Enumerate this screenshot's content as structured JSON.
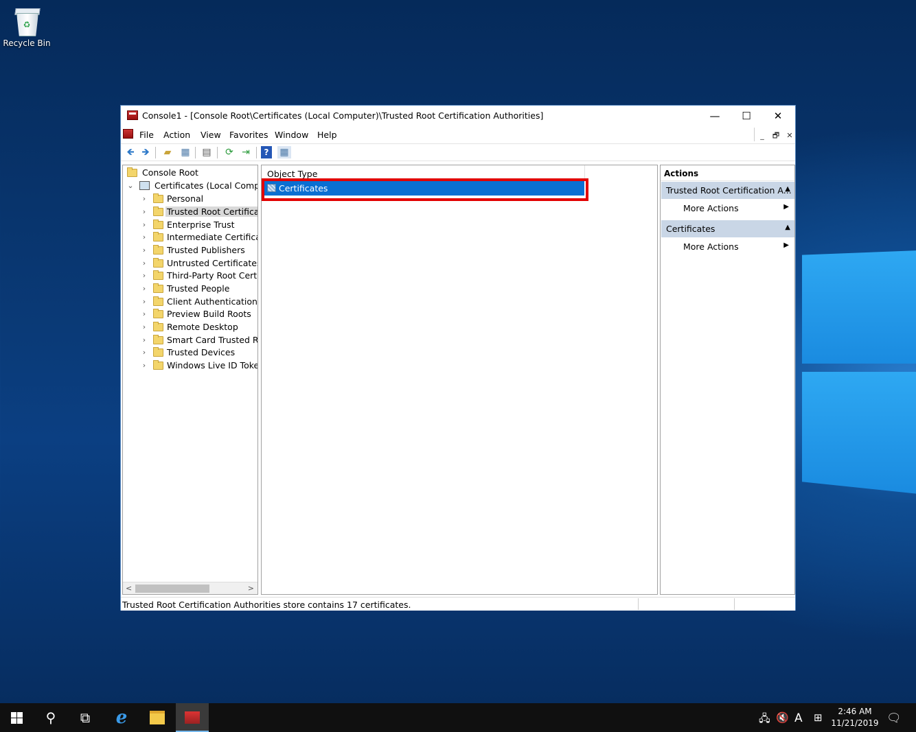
{
  "desktop": {
    "recycle_bin_label": "Recycle Bin"
  },
  "window": {
    "title": "Console1 - [Console Root\\Certificates (Local Computer)\\Trusted Root Certification Authorities]",
    "min_icon": "minimize-icon",
    "max_icon": "maximize-icon",
    "close_icon": "close-icon"
  },
  "menu": {
    "items": [
      "File",
      "Action",
      "View",
      "Favorites",
      "Window",
      "Help"
    ]
  },
  "tree": {
    "root": "Console Root",
    "computer": "Certificates (Local Computer)",
    "stores": [
      "Personal",
      "Trusted Root Certification Authorities",
      "Enterprise Trust",
      "Intermediate Certification Authorities",
      "Trusted Publishers",
      "Untrusted Certificates",
      "Third-Party Root Certification Authorities",
      "Trusted People",
      "Client Authentication Issuers",
      "Preview Build Roots",
      "Remote Desktop",
      "Smart Card Trusted Roots",
      "Trusted Devices",
      "Windows Live ID Token Issuer"
    ],
    "selected_index": 1
  },
  "list": {
    "column_header": "Object Type",
    "rows": [
      "Certificates"
    ]
  },
  "actions": {
    "header": "Actions",
    "section1_title": "Trusted Root Certification A...",
    "section1_item": "More Actions",
    "section2_title": "Certificates",
    "section2_item": "More Actions"
  },
  "status_text": "Trusted Root Certification Authorities store contains 17 certificates.",
  "taskbar": {
    "time": "2:46 AM",
    "date": "11/21/2019",
    "ime_indicator": "A"
  },
  "colors": {
    "selection": "#0a6fd2",
    "highlight_box": "#e20000",
    "actions_section": "#c9d6e6"
  }
}
